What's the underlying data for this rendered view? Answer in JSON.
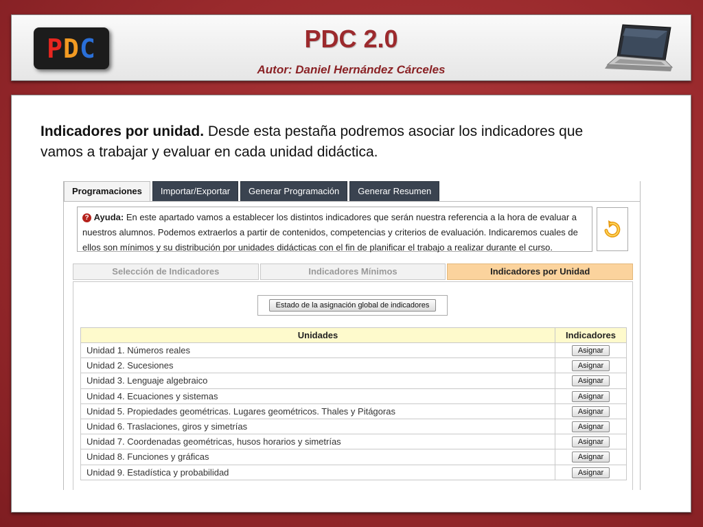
{
  "header": {
    "logo_letters": [
      "P",
      "D",
      "C"
    ],
    "title": "PDC 2.0",
    "author": "Autor:  Daniel Hernández Cárceles"
  },
  "intro": {
    "bold": "Indicadores por unidad.",
    "text": " Desde esta pestaña podremos asociar los indicadores que vamos a trabajar y evaluar en cada unidad didáctica."
  },
  "tabs": [
    {
      "label": "Programaciones",
      "active": true
    },
    {
      "label": "Importar/Exportar",
      "active": false
    },
    {
      "label": "Generar Programación",
      "active": false
    },
    {
      "label": "Generar Resumen",
      "active": false
    }
  ],
  "help": {
    "label": "Ayuda:",
    "text": " En este apartado vamos a establecer los distintos indicadores que serán nuestra referencia a la hora de evaluar a nuestros alumnos. Podemos extraerlos a partir de contenidos, competencias y criterios de evaluación. Indicaremos cuales de ellos son mínimos y su distribución por unidades didácticas con el fin de planificar el trabajo a realizar durante el curso."
  },
  "subtabs": [
    {
      "label": "Selección de Indicadores",
      "active": false
    },
    {
      "label": "Indicadores Mínimos",
      "active": false
    },
    {
      "label": "Indicadores por Unidad",
      "active": true
    }
  ],
  "status_button": "Estado de la asignación global de indicadores",
  "table": {
    "headers": [
      "Unidades",
      "Indicadores"
    ],
    "assign_label": "Asignar",
    "rows": [
      "Unidad 1. Números reales",
      "Unidad 2. Sucesiones",
      "Unidad 3. Lenguaje algebraico",
      "Unidad 4. Ecuaciones y sistemas",
      "Unidad 5. Propiedades geométricas. Lugares geométricos. Thales y Pitágoras",
      "Unidad 6. Traslaciones, giros y simetrías",
      "Unidad 7. Coordenadas geométricas, husos horarios y simetrías",
      "Unidad 8. Funciones y gráficas",
      "Unidad 9. Estadística y probabilidad"
    ]
  },
  "colors": {
    "title": "#9c2a2d",
    "active_subtab": "#fbd39d",
    "table_header": "#fefacc",
    "tab_dark": "#3a4350"
  }
}
